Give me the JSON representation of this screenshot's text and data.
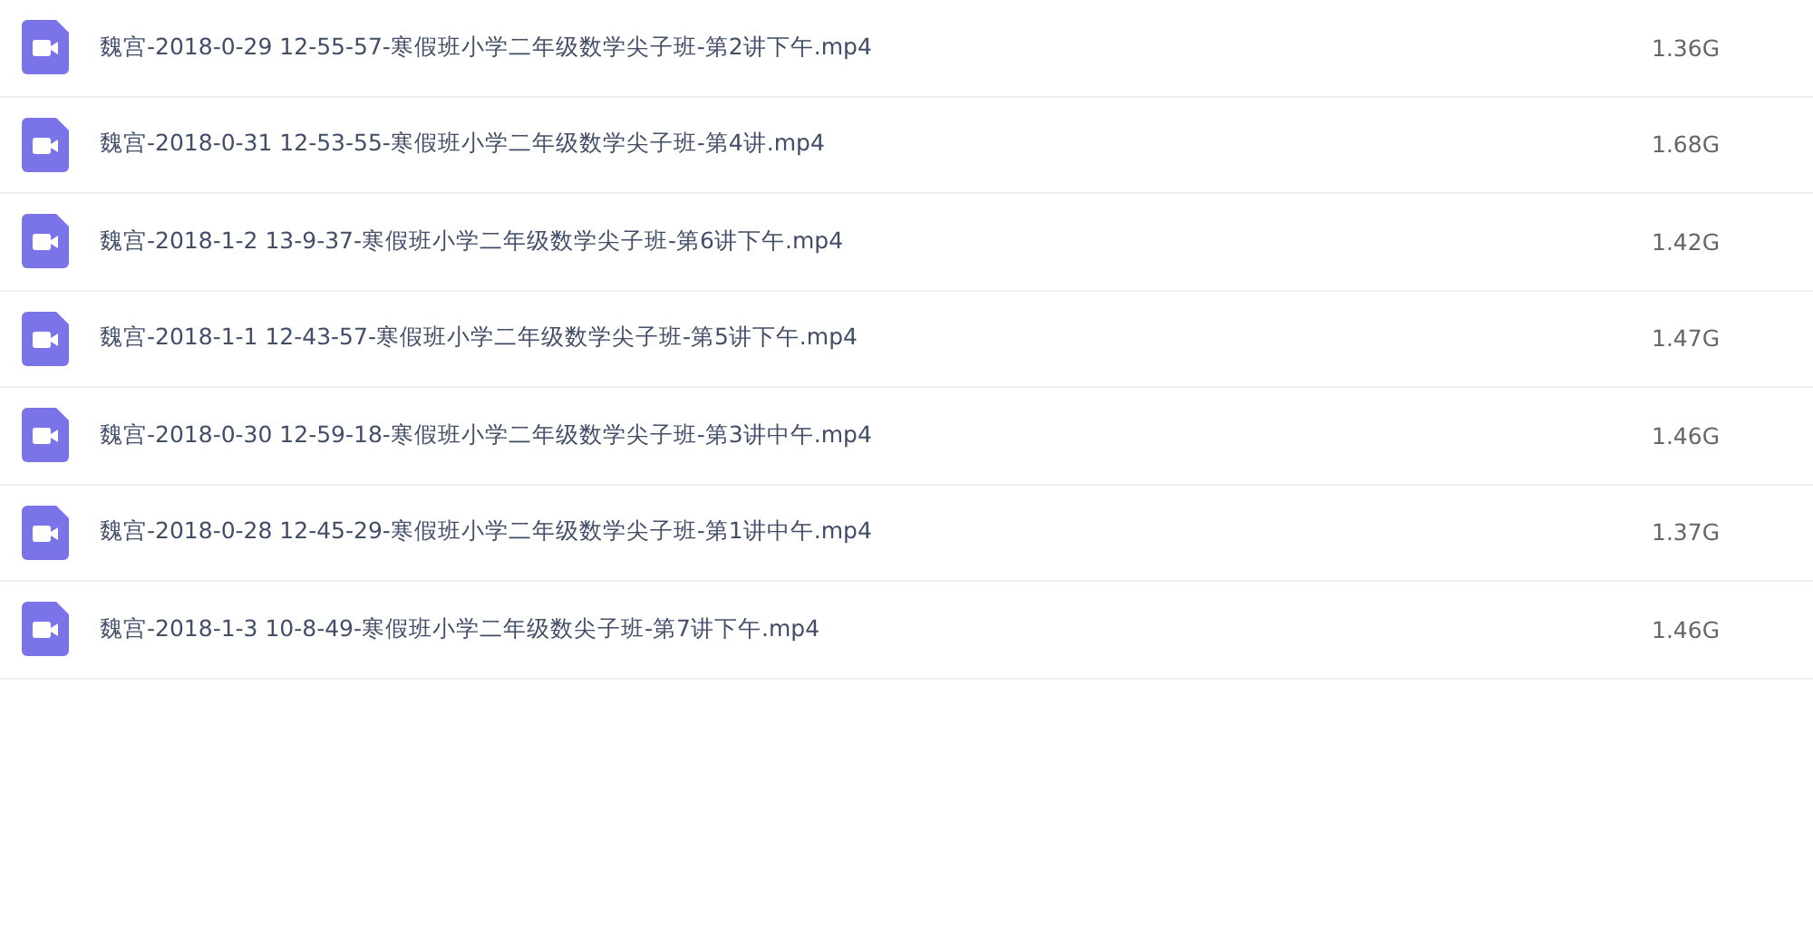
{
  "files": [
    {
      "name": "魏宫-2018-0-29 12-55-57-寒假班小学二年级数学尖子班-第2讲下午.mp4",
      "size": "1.36G"
    },
    {
      "name": "魏宫-2018-0-31 12-53-55-寒假班小学二年级数学尖子班-第4讲.mp4",
      "size": "1.68G"
    },
    {
      "name": "魏宫-2018-1-2 13-9-37-寒假班小学二年级数学尖子班-第6讲下午.mp4",
      "size": "1.42G"
    },
    {
      "name": "魏宫-2018-1-1 12-43-57-寒假班小学二年级数学尖子班-第5讲下午.mp4",
      "size": "1.47G"
    },
    {
      "name": "魏宫-2018-0-30 12-59-18-寒假班小学二年级数学尖子班-第3讲中午.mp4",
      "size": "1.46G"
    },
    {
      "name": "魏宫-2018-0-28 12-45-29-寒假班小学二年级数学尖子班-第1讲中午.mp4",
      "size": "1.37G"
    },
    {
      "name": "魏宫-2018-1-3 10-8-49-寒假班小学二年级数尖子班-第7讲下午.mp4",
      "size": "1.46G"
    }
  ]
}
